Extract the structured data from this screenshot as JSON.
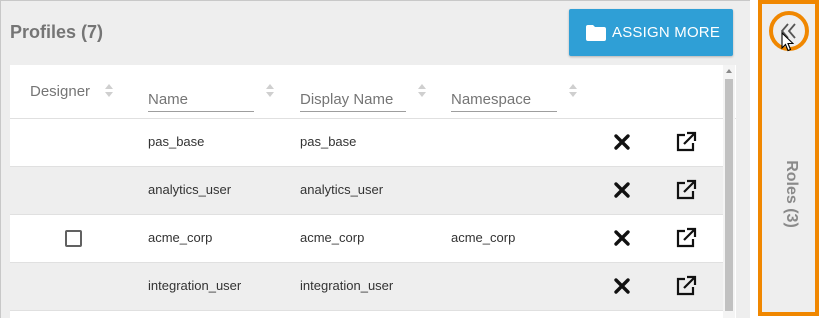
{
  "profiles_panel": {
    "title": "Profiles (7)",
    "assign_button_label": "ASSIGN MORE"
  },
  "table": {
    "columns": {
      "designer": "Designer",
      "name": "Name",
      "display_name": "Display Name",
      "namespace": "Namespace"
    },
    "rows": [
      {
        "name": "pas_base",
        "display_name": "pas_base",
        "namespace": "",
        "designer_checkbox": false
      },
      {
        "name": "analytics_user",
        "display_name": "analytics_user",
        "namespace": "",
        "designer_checkbox": false
      },
      {
        "name": "acme_corp",
        "display_name": "acme_corp",
        "namespace": "acme_corp",
        "designer_checkbox": true
      },
      {
        "name": "integration_user",
        "display_name": "integration_user",
        "namespace": "",
        "designer_checkbox": false
      }
    ],
    "row_actions": [
      "close-icon",
      "open-external-icon"
    ]
  },
  "roles_panel": {
    "label": "Roles (3)",
    "collapse_icon": "double-chevron-left-icon"
  },
  "colors": {
    "accent_button": "#2f9fd6",
    "highlight_orange": "#f08700"
  }
}
